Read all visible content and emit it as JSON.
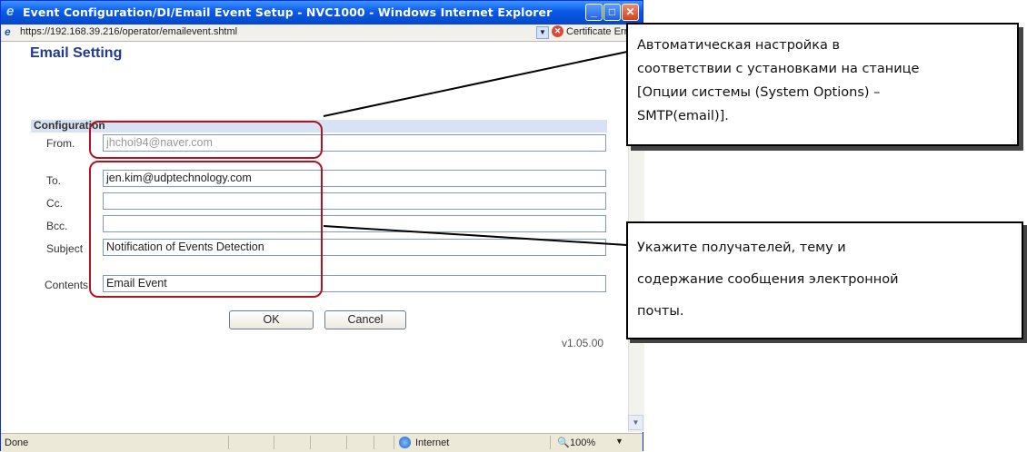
{
  "window": {
    "title": "Event Configuration/DI/Email Event Setup - NVC1000 - Windows Internet Explorer",
    "buttons": {
      "minimize": "_",
      "maximize": "□",
      "close": "✕"
    }
  },
  "address_bar": {
    "url": "https://192.168.39.216/operator/emailevent.shtml",
    "certificate_text": "Certificate Error"
  },
  "page": {
    "heading": "Email Setting",
    "section_label": "Configuration",
    "fields": {
      "from": {
        "label": "From.",
        "value": "jhchoi94@naver.com"
      },
      "to": {
        "label": "To.",
        "value": "jen.kim@udptechnology.com"
      },
      "cc": {
        "label": "Cc.",
        "value": ""
      },
      "bcc": {
        "label": "Bcc.",
        "value": ""
      },
      "subject": {
        "label": "Subject",
        "value": "Notification of Events Detection"
      },
      "contents": {
        "label": "Contents",
        "value": "Email Event"
      }
    },
    "ok_label": "OK",
    "cancel_label": "Cancel",
    "version": "v1.05.00"
  },
  "status_bar": {
    "status": "Done",
    "zone": "Internet",
    "zoom": "100%"
  },
  "callouts": {
    "top": {
      "line1": "Автоматическая настройка в",
      "line2": "соответствии с установками на станице",
      "line3": "[Опции системы (System Options) –",
      "line4": "SMTP(email)]."
    },
    "bottom": {
      "line1": "Укажите получателей, тему и",
      "line2": "содержание сообщения электронной",
      "line3": "почты."
    }
  },
  "colors": {
    "title_bar": "#0a5ae8",
    "heading": "#1f3a93",
    "highlight": "#b2131f"
  }
}
